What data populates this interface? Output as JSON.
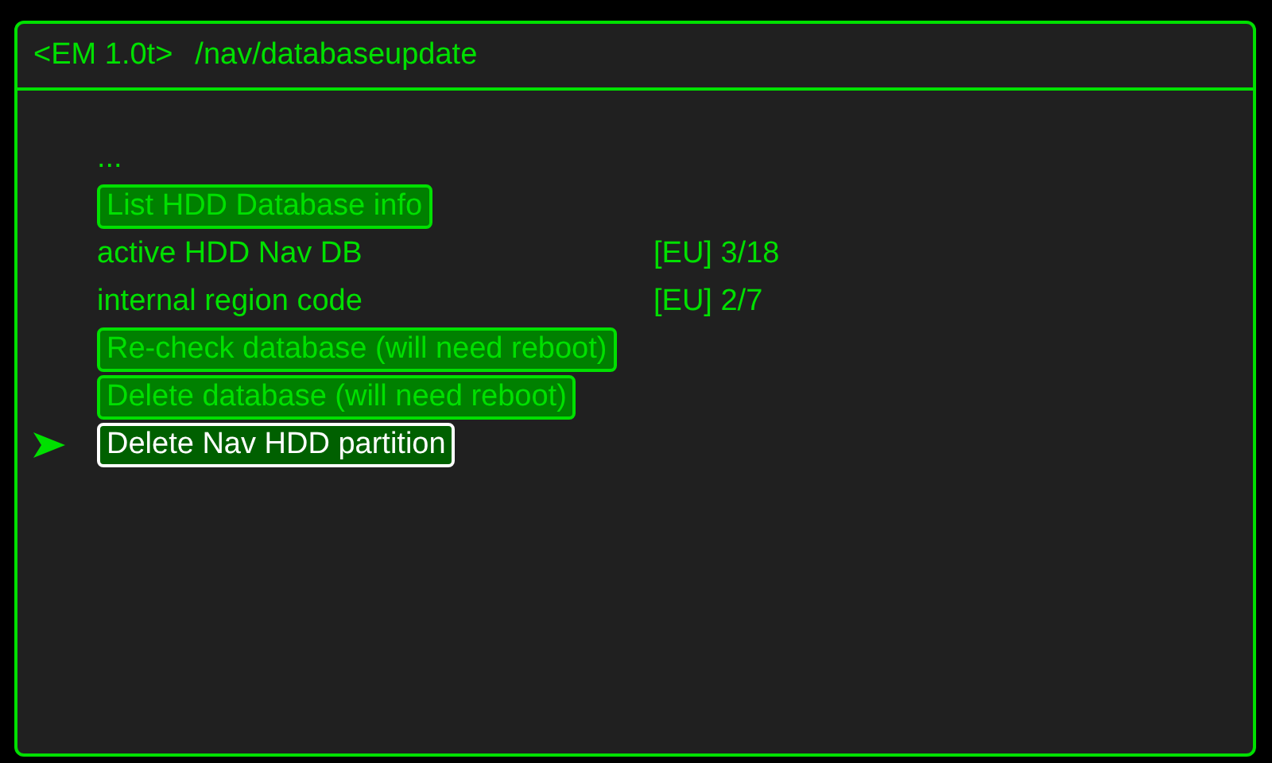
{
  "window": {
    "title": "<EM 1.0t>",
    "path": "/nav/databaseupdate"
  },
  "items": [
    {
      "kind": "text",
      "label": "..."
    },
    {
      "kind": "button",
      "label": "List HDD Database info",
      "selected": false
    },
    {
      "kind": "info",
      "label": "active HDD Nav DB",
      "value": "[EU] 3/18"
    },
    {
      "kind": "info",
      "label": "internal region code",
      "value": "[EU] 2/7"
    },
    {
      "kind": "button",
      "label": "Re-check database (will need reboot)",
      "selected": false
    },
    {
      "kind": "button",
      "label": "Delete database (will need reboot)",
      "selected": false
    },
    {
      "kind": "button",
      "label": "Delete Nav HDD partition",
      "selected": true
    }
  ]
}
